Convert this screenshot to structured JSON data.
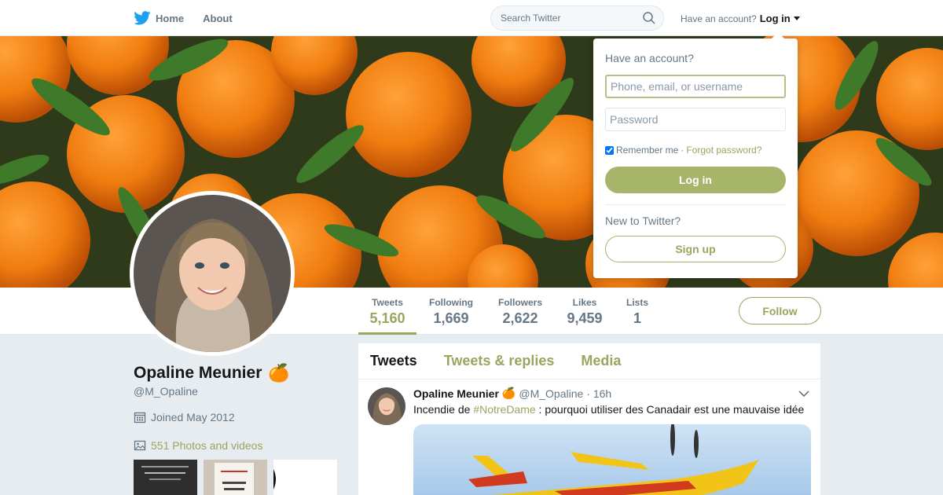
{
  "nav": {
    "home_label": "Home",
    "about_label": "About",
    "search_placeholder": "Search Twitter",
    "account_prompt": "Have an account?",
    "login_label": "Log in"
  },
  "profile_nav": {
    "stats": [
      {
        "label": "Tweets",
        "value": "5,160",
        "active": true
      },
      {
        "label": "Following",
        "value": "1,669"
      },
      {
        "label": "Followers",
        "value": "2,622"
      },
      {
        "label": "Likes",
        "value": "9,459"
      },
      {
        "label": "Lists",
        "value": "1"
      }
    ],
    "follow_label": "Follow"
  },
  "profile": {
    "name": "Opaline Meunier",
    "emoji": "🍊",
    "handle": "@M_Opaline",
    "joined": "Joined May 2012",
    "photos_label": "551 Photos and videos"
  },
  "timeline": {
    "tabs": [
      "Tweets",
      "Tweets & replies",
      "Media"
    ],
    "tweet": {
      "name": "Opaline Meunier",
      "handle": "@M_Opaline",
      "time": "· 16h",
      "text_before": "Incendie de ",
      "hashtag": "#NotreDame",
      "text_after": " : pourquoi utiliser des Canadair est une mauvaise idée"
    }
  },
  "login_dropdown": {
    "title": "Have an account?",
    "username_placeholder": "Phone, email, or username",
    "password_placeholder": "Password",
    "remember_label": "Remember me",
    "separator": "·",
    "forgot_label": "Forgot password?",
    "login_button": "Log in",
    "new_prompt": "New to Twitter?",
    "signup_button": "Sign up"
  },
  "colors": {
    "accent": "#98a65f",
    "login_button": "#a7b56b",
    "background": "#e6ecf0",
    "twitter_blue": "#1da1f2"
  },
  "icons": [
    "twitter-bird-icon",
    "search-icon",
    "calendar-icon",
    "photo-icon",
    "chevron-down-icon"
  ]
}
